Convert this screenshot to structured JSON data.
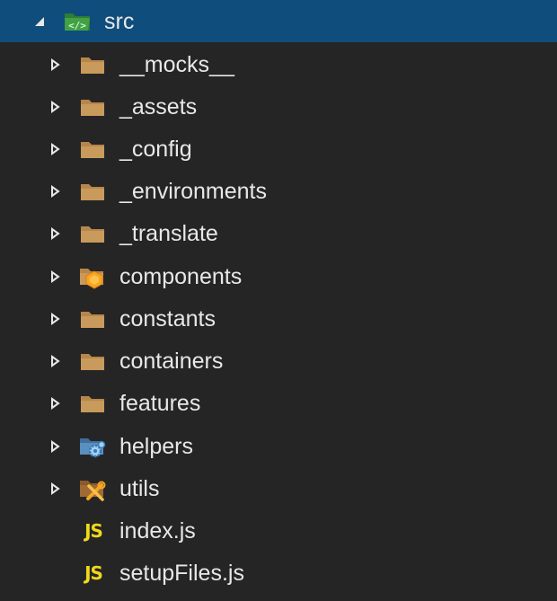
{
  "explorer": {
    "root": {
      "label": "src",
      "icon": "folder-src-open-icon",
      "expanded": true
    },
    "items": [
      {
        "label": "__mocks__",
        "icon": "folder-icon",
        "kind": "folder"
      },
      {
        "label": "_assets",
        "icon": "folder-icon",
        "kind": "folder"
      },
      {
        "label": "_config",
        "icon": "folder-icon",
        "kind": "folder"
      },
      {
        "label": "_environments",
        "icon": "folder-icon",
        "kind": "folder"
      },
      {
        "label": "_translate",
        "icon": "folder-icon",
        "kind": "folder"
      },
      {
        "label": "components",
        "icon": "folder-components-icon",
        "kind": "folder"
      },
      {
        "label": "constants",
        "icon": "folder-icon",
        "kind": "folder"
      },
      {
        "label": "containers",
        "icon": "folder-icon",
        "kind": "folder"
      },
      {
        "label": "features",
        "icon": "folder-icon",
        "kind": "folder"
      },
      {
        "label": "helpers",
        "icon": "folder-helpers-icon",
        "kind": "folder"
      },
      {
        "label": "utils",
        "icon": "folder-utils-icon",
        "kind": "folder"
      },
      {
        "label": "index.js",
        "icon": "js-file-icon",
        "kind": "file",
        "badge": "JS"
      },
      {
        "label": "setupFiles.js",
        "icon": "js-file-icon",
        "kind": "file",
        "badge": "JS"
      }
    ]
  },
  "colors": {
    "background": "#252526",
    "selected_row": "#0f4d7c",
    "text": "#e8e8e8",
    "folder": "#c09553",
    "js_badge": "#f0d81c",
    "src_folder": "#3fa34d"
  }
}
